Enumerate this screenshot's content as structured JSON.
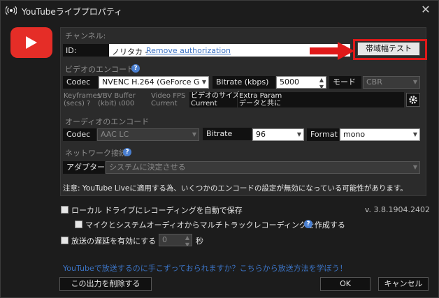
{
  "window": {
    "title": "YouTubeライブプロパティ",
    "close_glyph": "✕"
  },
  "channel": {
    "section_label": "チャンネル:",
    "id_label": "ID:",
    "id_value": "ノリタカ - ",
    "remove_link": "Remove authorization",
    "bandwidth_button": "帯域幅テスト"
  },
  "video": {
    "section_label": "ビデオのエンコード",
    "codec_label": "Codec",
    "codec_value": "NVENC H.264 (GeForce G",
    "bitrate_label": "Bitrate (kbps)",
    "bitrate_value": "5000",
    "mode_label": "モード",
    "mode_value": "CBR",
    "adv": {
      "keyframes_line1": "Keyframes",
      "keyframes_line2": "(secs) ?",
      "vbv_line1": "VBV Buffer",
      "vbv_line2": "(kbit) ι000",
      "fps_line1": "Video FPS",
      "fps_line2": "Current",
      "size_line1": "ビデオのサイズ",
      "size_line2": "Current",
      "param_line1": "Extra Param",
      "param_line2": "データと共に"
    }
  },
  "audio": {
    "section_label": "オーディオのエンコード",
    "codec_label": "Codec",
    "codec_value": "AAC LC",
    "bitrate_label": "Bitrate",
    "bitrate_value": "96",
    "format_label": "Format",
    "format_value": "mono"
  },
  "network": {
    "section_label": "ネットワーク接続",
    "adapter_label": "アダプター",
    "adapter_value": "システムに決定させる"
  },
  "notice": "注意: YouTube Liveに適用する為、いくつかのエンコードの設定が無効になっている可能性があります。",
  "options": {
    "record_local": "ローカル ドライブにレコーディングを自動で保存",
    "multitrack": "マイクとシステムオーディオからマルチトラックレコーディングを作成する",
    "delay": "放送の遅延を有効にする",
    "delay_value": "0",
    "delay_unit": "秒",
    "version": "v. 3.8.1904.2402"
  },
  "footer": {
    "help_link": "YouTubeで放送するのに手こずっておられますか？こちらから放送方法を学ぼう！",
    "delete_button": "この出力を削除する",
    "ok_button": "OK",
    "cancel_button": "キャンセル"
  },
  "colors": {
    "accent_red": "#e01919",
    "youtube_red": "#e52d27",
    "link_blue": "#3b73c4"
  }
}
